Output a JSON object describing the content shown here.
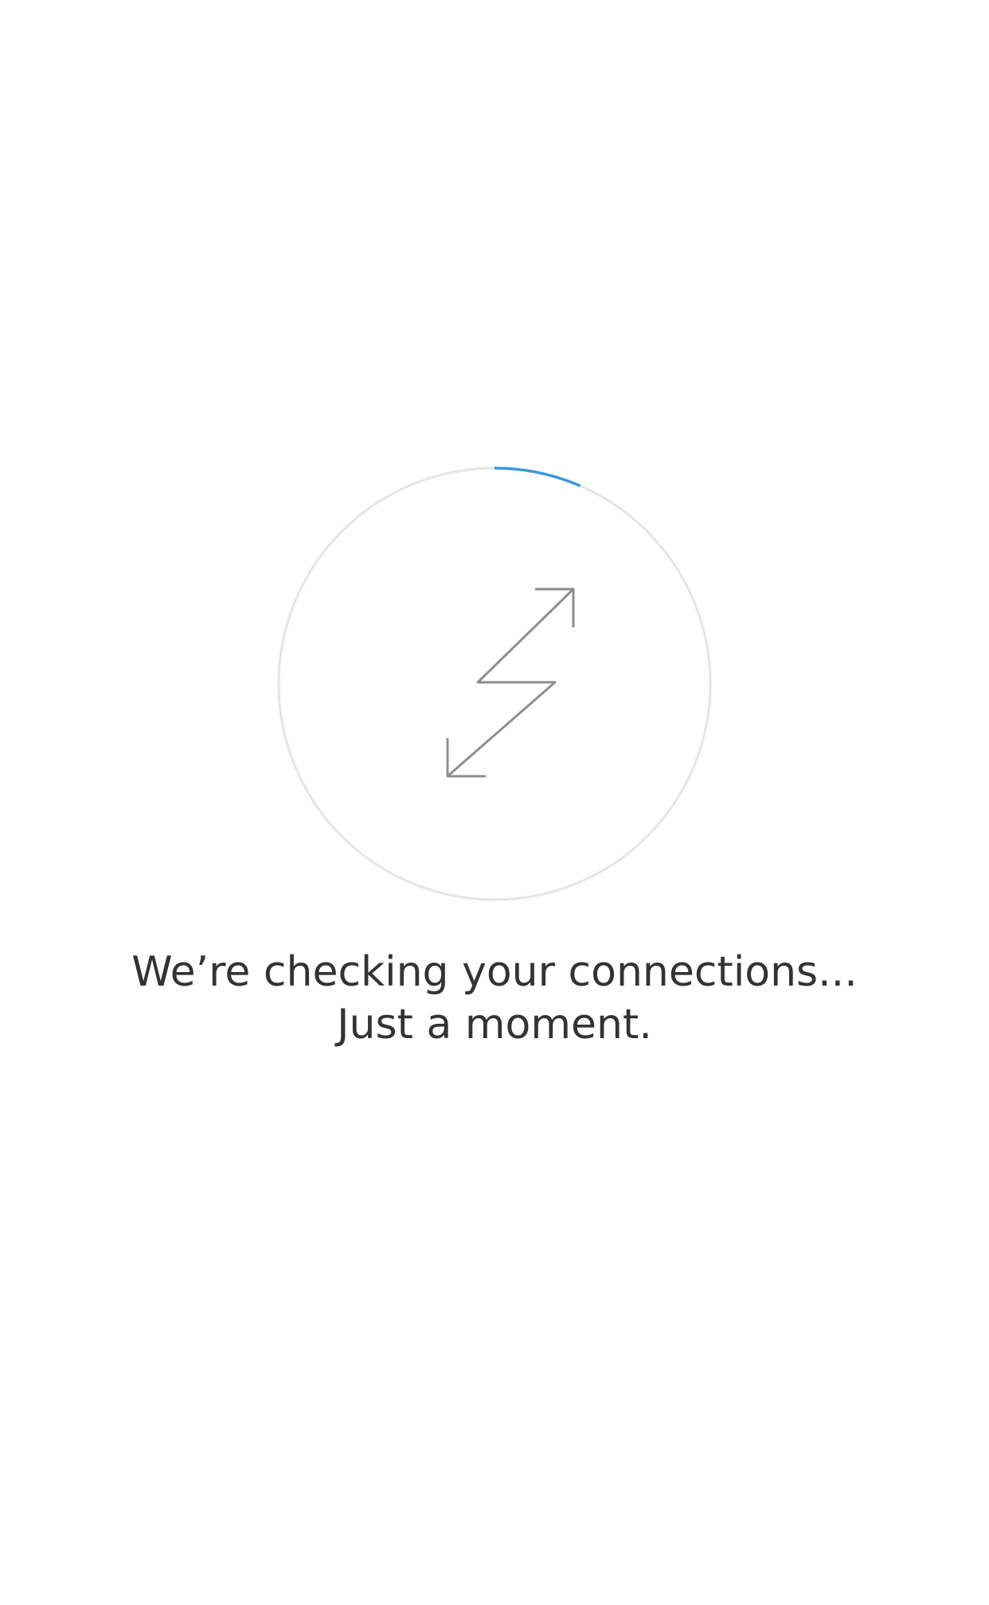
{
  "status": {
    "line1": "We’re checking your connections...",
    "line2": "Just a moment."
  },
  "progress": {
    "fraction": 0.065
  },
  "icons": {
    "center": "connection-bolt-icon"
  },
  "colors": {
    "background": "#ffffff",
    "ring_track": "#e5e5e5",
    "ring_progress": "#3a9ad9",
    "icon_stroke": "#8e8e8e",
    "text": "#333333"
  }
}
